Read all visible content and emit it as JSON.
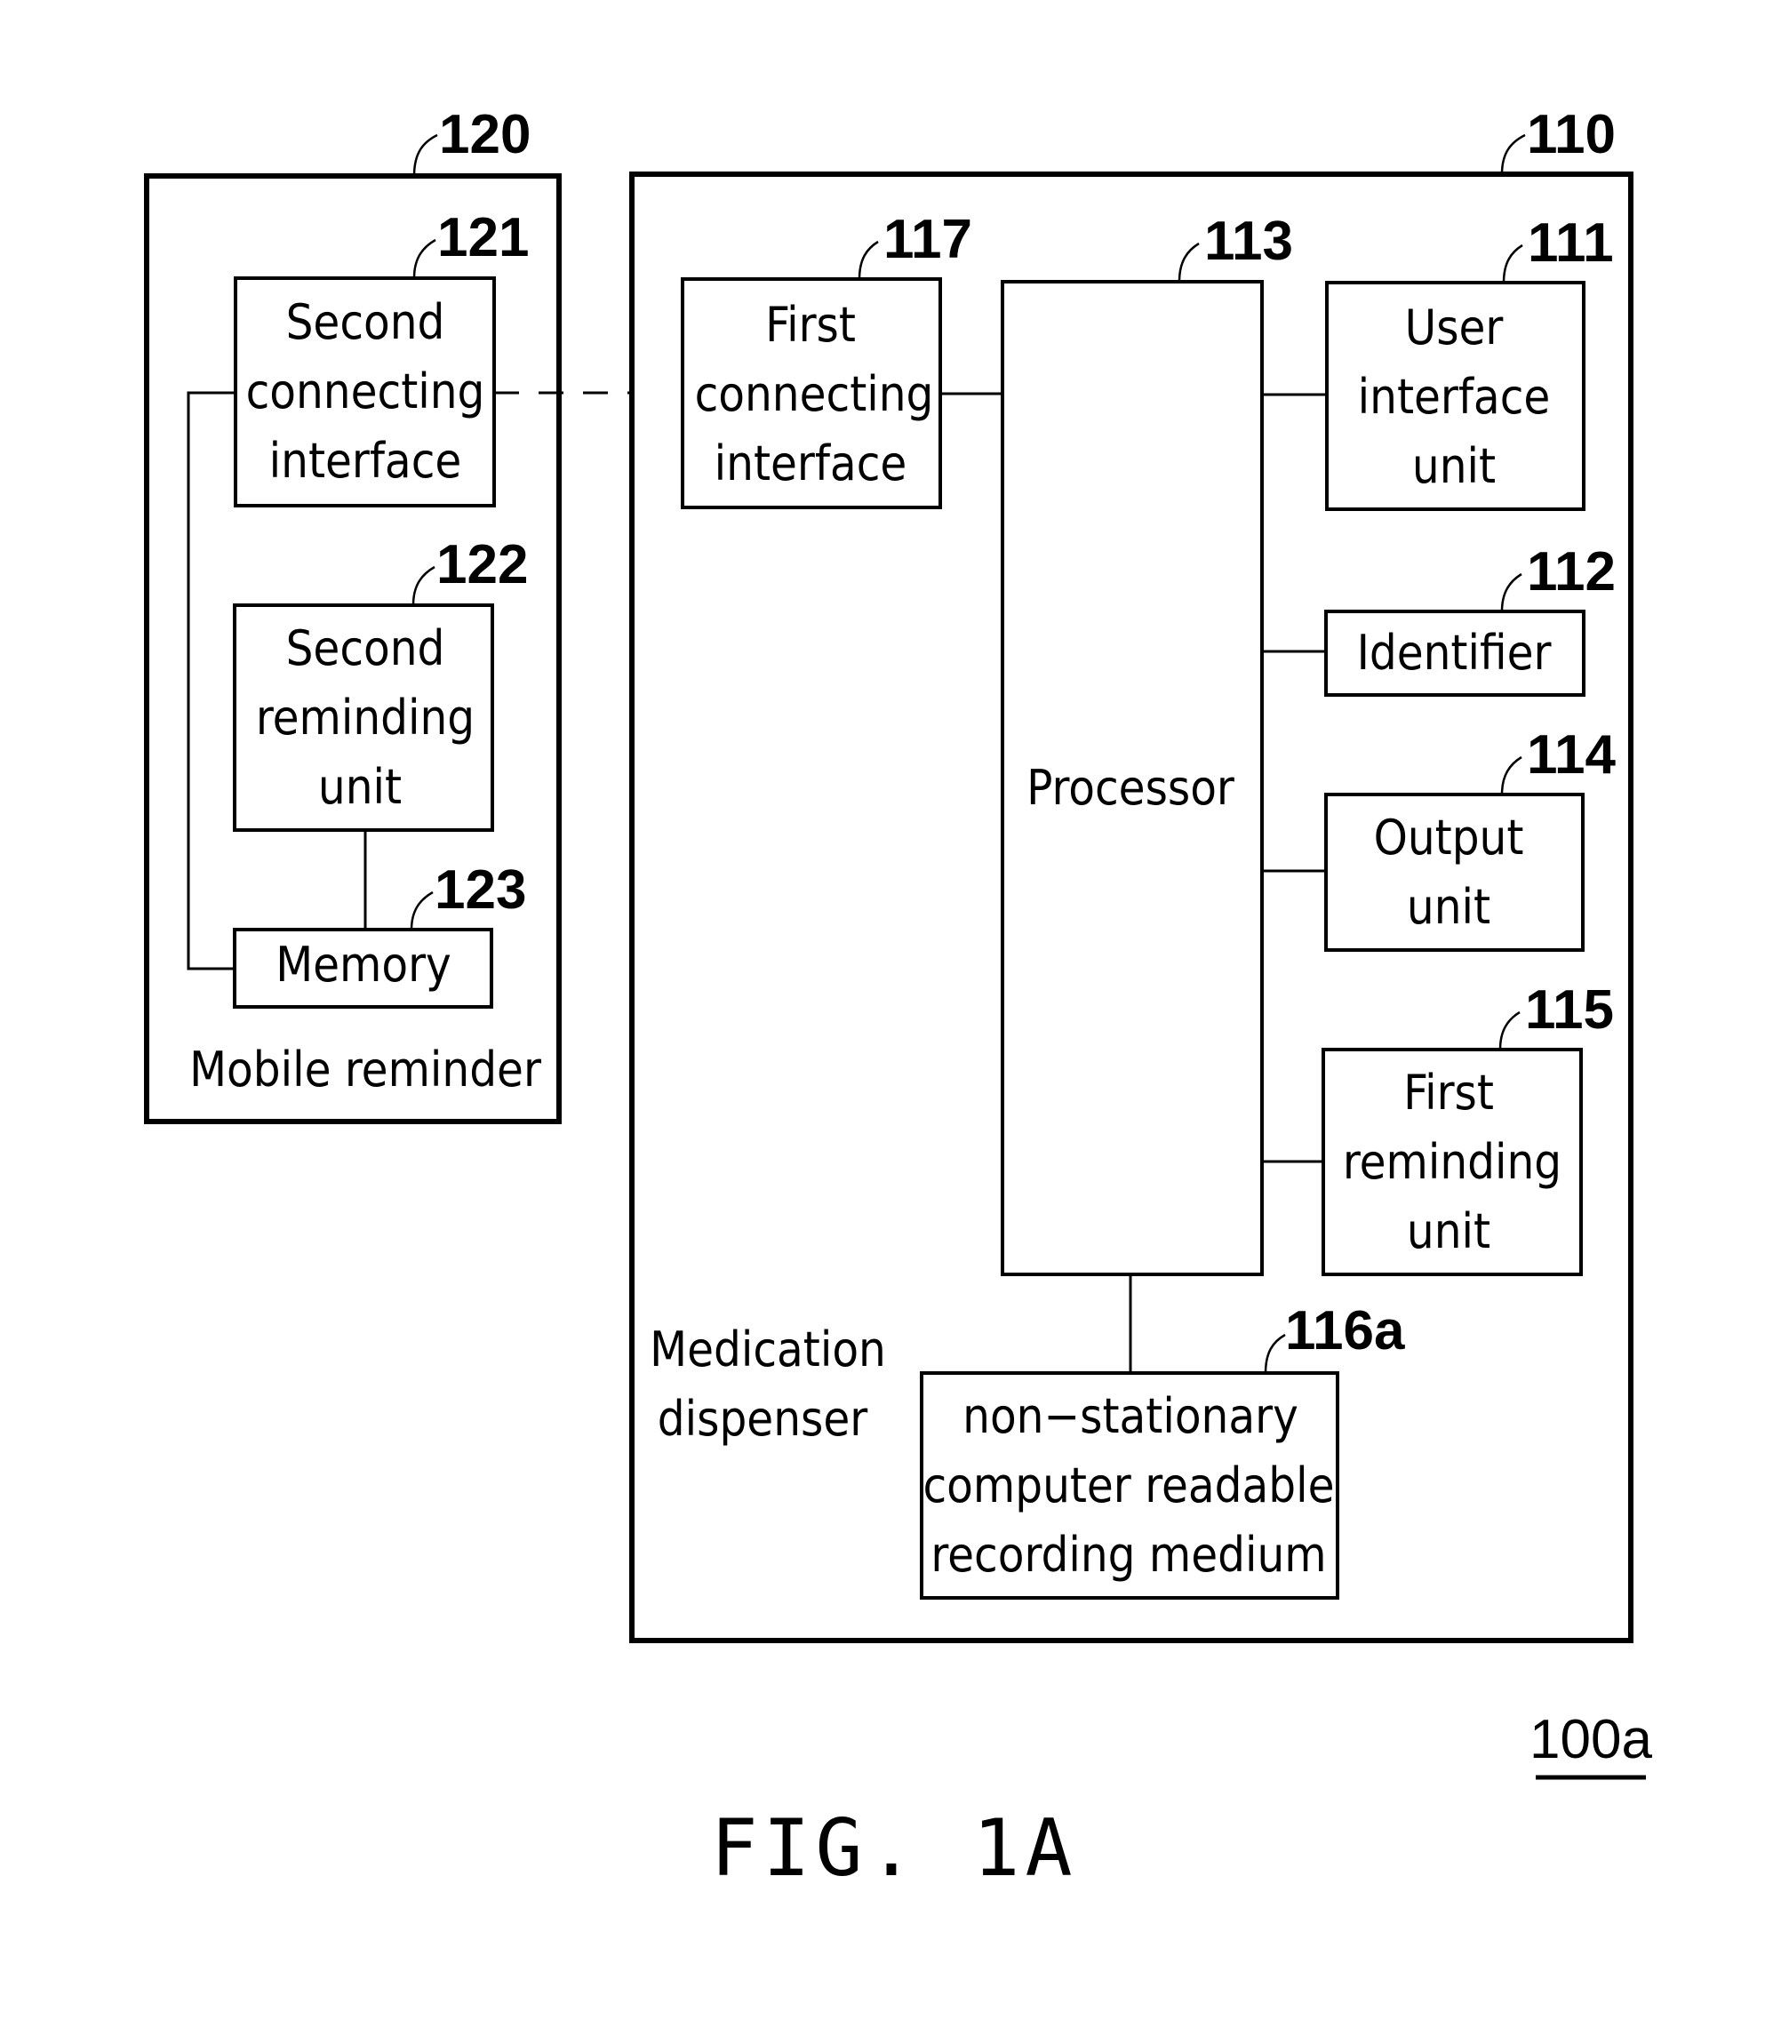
{
  "figure": {
    "caption": "FIG. 1A",
    "system_ref": "100a"
  },
  "mobile_reminder": {
    "ref": "120",
    "label": "Mobile reminder",
    "blocks": [
      {
        "ref": "121",
        "lines": [
          "Second",
          "connecting",
          "interface"
        ]
      },
      {
        "ref": "122",
        "lines": [
          "Second",
          "reminding",
          "unit"
        ]
      },
      {
        "ref": "123",
        "lines": [
          "Memory"
        ]
      }
    ]
  },
  "medication_dispenser": {
    "ref": "110",
    "label_lines": [
      "Medication",
      "dispenser"
    ],
    "blocks": [
      {
        "ref": "117",
        "lines": [
          "First",
          "connecting",
          "interface"
        ]
      },
      {
        "ref": "113",
        "lines": [
          "Processor"
        ]
      },
      {
        "ref": "111",
        "lines": [
          "User",
          "interface",
          "unit"
        ]
      },
      {
        "ref": "112",
        "lines": [
          "Identifier"
        ]
      },
      {
        "ref": "114",
        "lines": [
          "Output",
          "unit"
        ]
      },
      {
        "ref": "115",
        "lines": [
          "First",
          "reminding",
          "unit"
        ]
      },
      {
        "ref": "116a",
        "lines": [
          "non−stationary",
          "computer readable",
          "recording medium"
        ]
      }
    ]
  },
  "connections": [
    {
      "from": "121",
      "to": "117",
      "style": "dashed"
    },
    {
      "from": "117",
      "to": "113",
      "style": "solid"
    },
    {
      "from": "113",
      "to": "111",
      "style": "solid"
    },
    {
      "from": "113",
      "to": "112",
      "style": "solid"
    },
    {
      "from": "113",
      "to": "114",
      "style": "solid"
    },
    {
      "from": "113",
      "to": "115",
      "style": "solid"
    },
    {
      "from": "113",
      "to": "116a",
      "style": "solid"
    },
    {
      "from": "122",
      "to": "123",
      "style": "solid"
    },
    {
      "from": "121",
      "to": "123",
      "style": "solid"
    }
  ]
}
